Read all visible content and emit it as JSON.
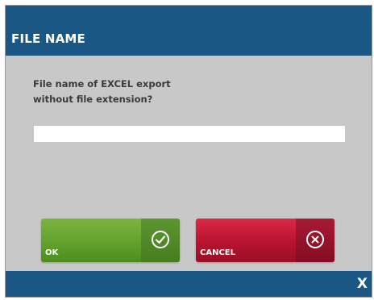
{
  "dialog": {
    "title": "FILE NAME",
    "prompt": "File name of EXCEL export\nwithout file extension?",
    "input_value": "",
    "input_placeholder": ""
  },
  "buttons": {
    "ok_label": "OK",
    "ok_icon": "check-circle-icon",
    "cancel_label": "CANCEL",
    "cancel_icon": "x-circle-icon",
    "close_label": "X"
  },
  "colors": {
    "bar": "#1a5784",
    "panel": "#c8c8c8",
    "ok": "#62a22d",
    "cancel": "#b8132f"
  }
}
